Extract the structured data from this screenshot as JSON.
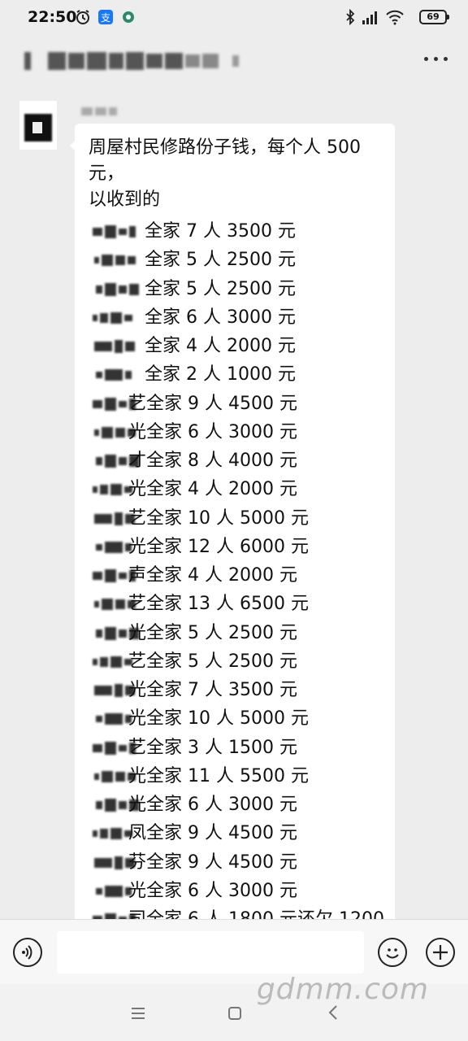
{
  "status_bar": {
    "time": "22:50",
    "battery": "69",
    "icons": [
      "alarm-icon",
      "app-icon",
      "notification-dot-icon",
      "bluetooth-icon",
      "signal-icon",
      "wifi-icon"
    ]
  },
  "header": {
    "title": "",
    "more_icon": "more-dots-icon"
  },
  "message": {
    "sender": "",
    "text_line1": "周屋村民修路份子钱，每个人 500",
    "text_line2": "元，",
    "text_line3": "以收到的",
    "rows": [
      {
        "name_tail": "",
        "text": "全家 7 人 3500 元"
      },
      {
        "name_tail": "",
        "text": "全家 5 人 2500 元"
      },
      {
        "name_tail": "",
        "text": "全家 5 人 2500 元"
      },
      {
        "name_tail": "",
        "text": "全家 6 人 3000 元"
      },
      {
        "name_tail": "",
        "text": "全家 4 人 2000 元"
      },
      {
        "name_tail": "",
        "text": "全家 2 人 1000 元"
      },
      {
        "name_tail": "艺",
        "text": "全家 9 人 4500 元"
      },
      {
        "name_tail": "光",
        "text": "全家 6 人 3000 元"
      },
      {
        "name_tail": "才",
        "text": "全家 8 人 4000 元"
      },
      {
        "name_tail": "光",
        "text": "全家 4 人 2000 元"
      },
      {
        "name_tail": "艺",
        "text": "全家 10 人 5000 元"
      },
      {
        "name_tail": "光",
        "text": "全家 12 人 6000 元"
      },
      {
        "name_tail": "声",
        "text": "全家 4 人 2000 元"
      },
      {
        "name_tail": "艺",
        "text": "全家 13 人 6500 元"
      },
      {
        "name_tail": "光",
        "text": "全家 5 人 2500 元"
      },
      {
        "name_tail": "艺",
        "text": "全家 5 人 2500 元"
      },
      {
        "name_tail": "光",
        "text": "全家 7 人 3500 元"
      },
      {
        "name_tail": "光",
        "text": "全家 10 人 5000 元"
      },
      {
        "name_tail": "艺",
        "text": "全家 3 人 1500 元"
      },
      {
        "name_tail": "光",
        "text": "全家 11 人 5500 元"
      },
      {
        "name_tail": "光",
        "text": "全家 6 人 3000 元"
      },
      {
        "name_tail": "凤",
        "text": "全家 9 人 4500 元"
      },
      {
        "name_tail": "芬",
        "text": "全家 9 人 4500 元"
      },
      {
        "name_tail": "光",
        "text": "全家 6 人 3000 元"
      },
      {
        "name_tail": "司",
        "text": "全家 6 人 1800 元还欠 1200"
      }
    ]
  },
  "input_bar": {
    "placeholder": "",
    "voice_icon": "voice-icon",
    "emoji_icon": "emoji-icon",
    "plus_icon": "plus-icon"
  },
  "nav_bar": {
    "icons": [
      "menu-icon",
      "home-icon",
      "back-icon"
    ]
  },
  "watermark": "gdmm.com"
}
